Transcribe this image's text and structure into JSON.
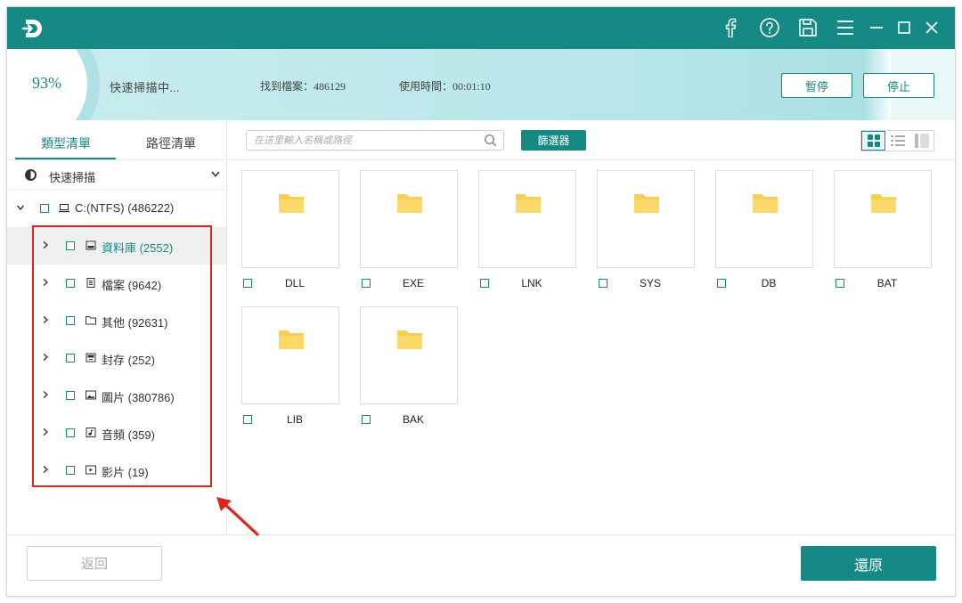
{
  "theme": {
    "accent": "#158a85",
    "annotation": "#e0241b",
    "folder": "#f7cf57"
  },
  "titlebar": {
    "icons": [
      "app-logo",
      "facebook-icon",
      "help-icon",
      "save-icon",
      "menu-icon",
      "minimize-icon",
      "maximize-icon",
      "close-icon"
    ]
  },
  "scan": {
    "percent": "93%",
    "progress": 0.93,
    "status": "快速掃描中...",
    "found": "找到檔案：486129",
    "elapsed": "使用時間：00:01:10",
    "pause_label": "暫停",
    "stop_label": "停止"
  },
  "sidebar": {
    "tabs": [
      {
        "label": "類型清單",
        "active": true
      },
      {
        "label": "路徑清單",
        "active": false
      }
    ],
    "scan_mode": "快速掃描",
    "drive": {
      "label": "C:(NTFS) (486222)"
    },
    "items": [
      {
        "label": "資料庫 (2552)",
        "icon": "database-icon",
        "selected": true
      },
      {
        "label": "檔案 (9642)",
        "icon": "document-icon",
        "selected": false
      },
      {
        "label": "其他 (92631)",
        "icon": "folder-outline-icon",
        "selected": false
      },
      {
        "label": "封存 (252)",
        "icon": "archive-icon",
        "selected": false
      },
      {
        "label": "圖片 (380786)",
        "icon": "image-icon",
        "selected": false
      },
      {
        "label": "音頻 (359)",
        "icon": "audio-icon",
        "selected": false
      },
      {
        "label": "影片 (19)",
        "icon": "video-icon",
        "selected": false
      }
    ]
  },
  "toolbar": {
    "search_placeholder": "在這里輸入名稱或路徑",
    "filter_label": "篩選器",
    "views": [
      "grid-view-icon",
      "list-view-icon",
      "detail-view-icon"
    ]
  },
  "grid": {
    "items": [
      {
        "label": "DLL"
      },
      {
        "label": "EXE"
      },
      {
        "label": "LNK"
      },
      {
        "label": "SYS"
      },
      {
        "label": "DB"
      },
      {
        "label": "BAT"
      },
      {
        "label": "LIB"
      },
      {
        "label": "BAK"
      }
    ]
  },
  "footer": {
    "back_label": "返回",
    "restore_label": "還原"
  }
}
